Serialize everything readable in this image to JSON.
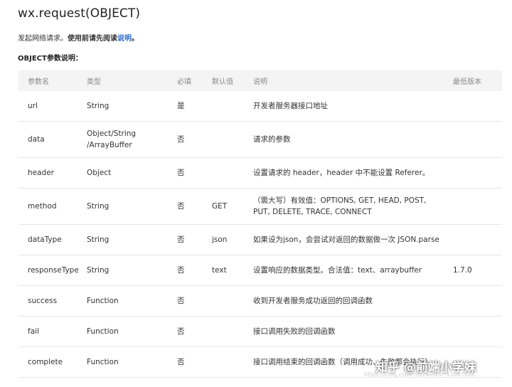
{
  "title": "wx.request(OBJECT)",
  "intro": {
    "text1": "发起网络请求。",
    "text2": "使用前请先阅读",
    "link": "说明",
    "text3": "。"
  },
  "section_title": "OBJECT参数说明：",
  "table": {
    "headers": [
      "参数名",
      "类型",
      "必填",
      "默认值",
      "说明",
      "最低版本"
    ],
    "rows": [
      {
        "name": "url",
        "type": "String",
        "required": "是",
        "default": "",
        "desc": "开发者服务器接口地址",
        "version": ""
      },
      {
        "name": "data",
        "type": "Object/String\n/ArrayBuffer",
        "required": "否",
        "default": "",
        "desc": "请求的参数",
        "version": ""
      },
      {
        "name": "header",
        "type": "Object",
        "required": "否",
        "default": "",
        "desc": "设置请求的 header，header 中不能设置 Referer。",
        "version": ""
      },
      {
        "name": "method",
        "type": "String",
        "required": "否",
        "default": "GET",
        "desc": "（需大写）有效值：OPTIONS, GET, HEAD, POST,\nPUT, DELETE, TRACE, CONNECT",
        "version": ""
      },
      {
        "name": "dataType",
        "type": "String",
        "required": "否",
        "default": "json",
        "desc": "如果设为json，会尝试对返回的数据做一次 JSON.parse",
        "version": ""
      },
      {
        "name": "responseType",
        "type": "String",
        "required": "否",
        "default": "text",
        "desc": "设置响应的数据类型。合法值：text、arraybuffer",
        "version": "1.7.0"
      },
      {
        "name": "success",
        "type": "Function",
        "required": "否",
        "default": "",
        "desc": "收到开发者服务成功返回的回调函数",
        "version": ""
      },
      {
        "name": "fail",
        "type": "Function",
        "required": "否",
        "default": "",
        "desc": "接口调用失败的回调函数",
        "version": ""
      },
      {
        "name": "complete",
        "type": "Function",
        "required": "否",
        "default": "",
        "desc": "接口调用结束的回调函数（调用成功、失败都会执行）",
        "version": ""
      }
    ]
  },
  "watermark": "知乎 @前端小学妹",
  "url_watermark": "https://blog.csdn.net/weixin_43087886"
}
